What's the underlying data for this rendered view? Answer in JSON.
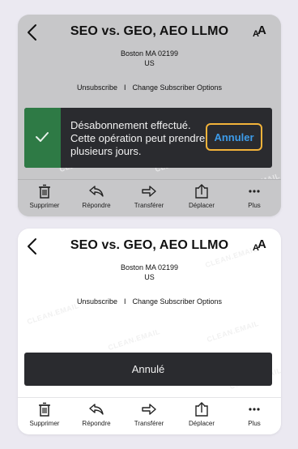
{
  "email": {
    "subject": "SEO vs. GEO, AEO LLMO",
    "address_line1": "Boston MA 02199",
    "address_line2": "US",
    "unsubscribe_link": "Unsubscribe",
    "separator": "I",
    "options_link": "Change Subscriber Options"
  },
  "top_toast": {
    "message": "Désabonnement effectué. Cette opération peut prendre plusieurs jours.",
    "undo_label": "Annuler",
    "colors": {
      "success": "#2e7a45",
      "highlight": "#f2b33a",
      "link": "#3d9be9"
    }
  },
  "bottom_toast": {
    "message": "Annulé"
  },
  "toolbar": {
    "delete_label": "Supprimer",
    "reply_label": "Répondre",
    "forward_label": "Transférer",
    "move_label": "Déplacer",
    "more_label": "Plus"
  },
  "font_toggle": {
    "large": "A",
    "small": "A"
  },
  "watermark_text": "CLEAN.EMAIL"
}
